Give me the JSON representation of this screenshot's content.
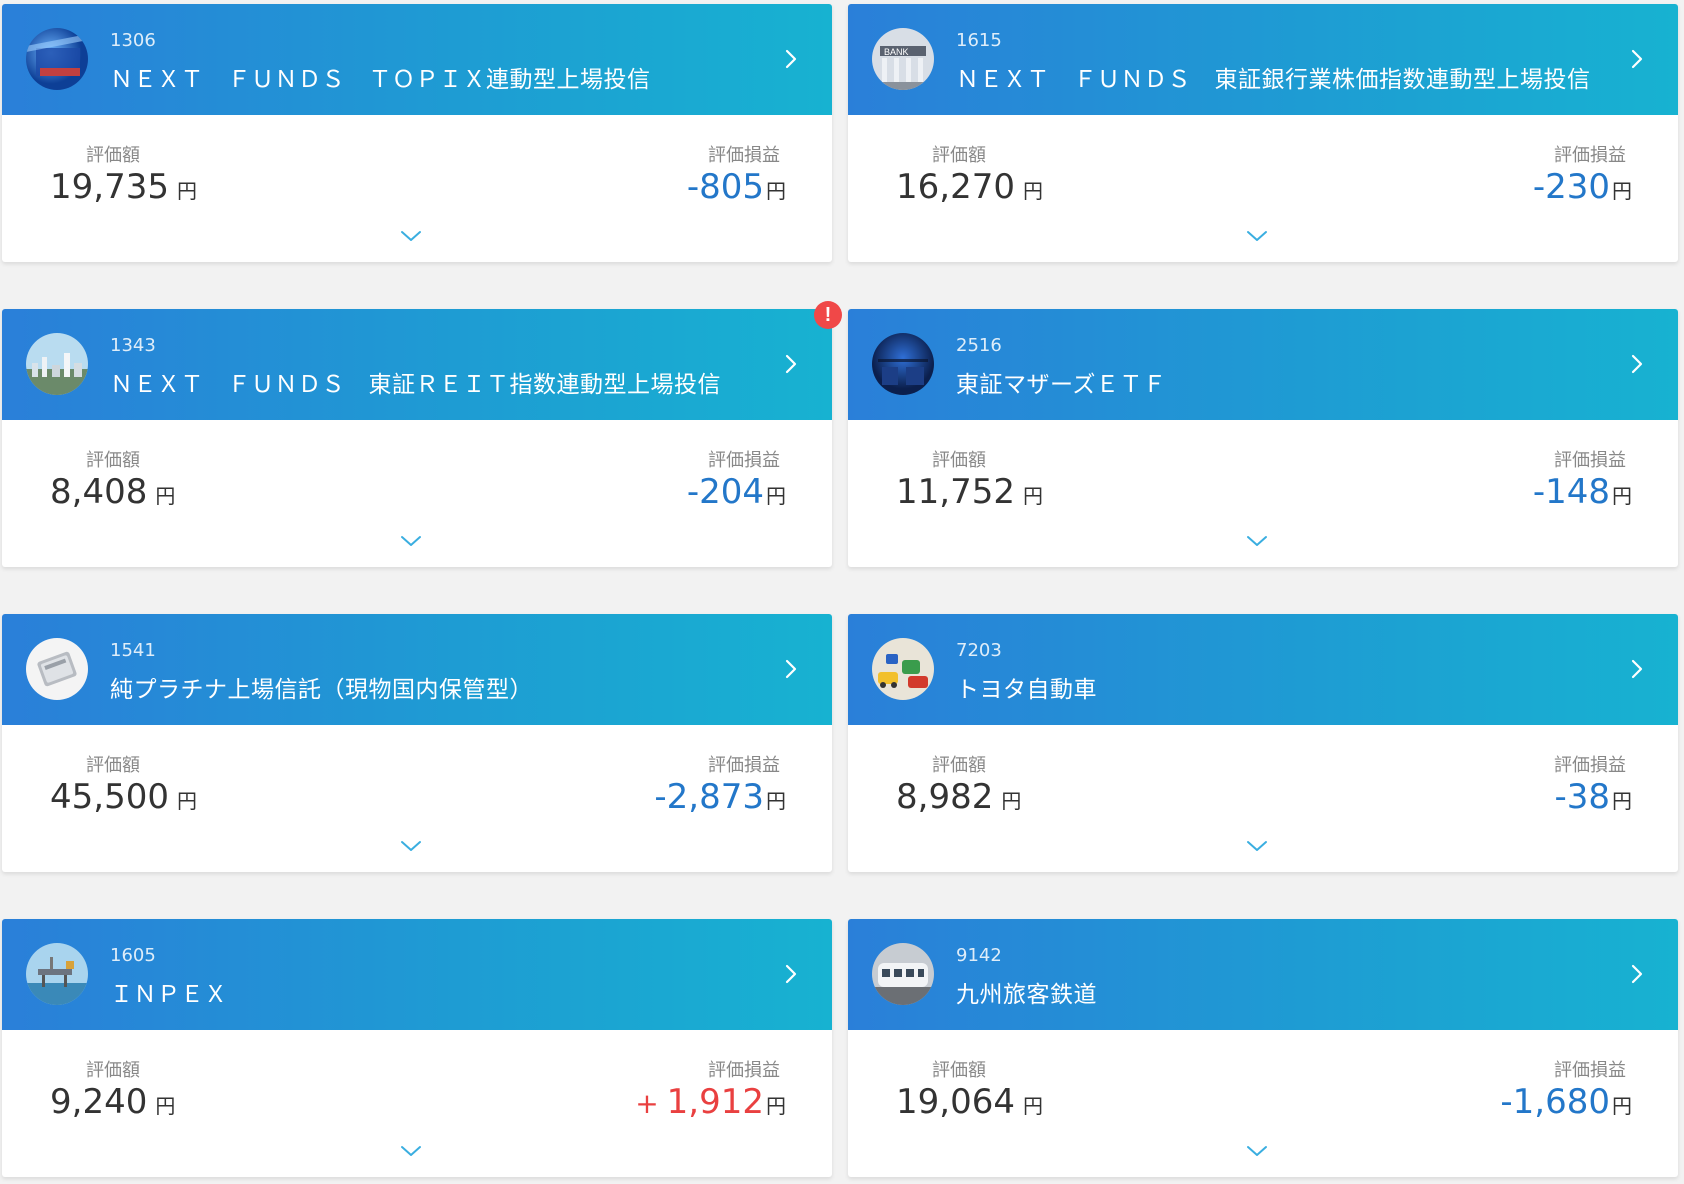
{
  "labels": {
    "valuation": "評価額",
    "profit_loss": "評価損益",
    "currency": "円"
  },
  "colors": {
    "header_start": "#2a7fd9",
    "header_end": "#17b2d1",
    "loss": "#2377c9",
    "gain": "#e94040",
    "alert": "#f04848"
  },
  "holdings": [
    {
      "code": "1306",
      "name": "ＮＥＸＴ　ＦＵＮＤＳ　ＴＯＰＩＸ連動型上場投信",
      "valuation": "19,735",
      "pl_sign": "",
      "pl": "-805",
      "direction": "negative",
      "icon": "building-photo",
      "alert": false
    },
    {
      "code": "1615",
      "name": "ＮＥＸＴ　ＦＵＮＤＳ　東証銀行業株価指数連動型上場投信",
      "valuation": "16,270",
      "pl_sign": "",
      "pl": "-230",
      "direction": "negative",
      "icon": "bank-photo",
      "alert": false
    },
    {
      "code": "1343",
      "name": "ＮＥＸＴ　ＦＵＮＤＳ　東証ＲＥＩＴ指数連動型上場投信",
      "valuation": "8,408",
      "pl_sign": "",
      "pl": "-204",
      "direction": "negative",
      "icon": "city-photo",
      "alert": true,
      "alert_text": "!"
    },
    {
      "code": "2516",
      "name": "東証マザーズＥＴＦ",
      "valuation": "11,752",
      "pl_sign": "",
      "pl": "-148",
      "direction": "negative",
      "icon": "office-photo",
      "alert": false
    },
    {
      "code": "1541",
      "name": "純プラチナ上場信託（現物国内保管型）",
      "valuation": "45,500",
      "pl_sign": "",
      "pl": "-2,873",
      "direction": "negative",
      "icon": "platinum-photo",
      "alert": false
    },
    {
      "code": "7203",
      "name": "トヨタ自動車",
      "valuation": "8,982",
      "pl_sign": "",
      "pl": "-38",
      "direction": "negative",
      "icon": "toy-cars-photo",
      "alert": false
    },
    {
      "code": "1605",
      "name": "ＩＮＰＥＸ",
      "valuation": "9,240",
      "pl_sign": "+",
      "pl": "1,912",
      "direction": "positive",
      "icon": "oil-platform-photo",
      "alert": false
    },
    {
      "code": "9142",
      "name": "九州旅客鉄道",
      "valuation": "19,064",
      "pl_sign": "",
      "pl": "-1,680",
      "direction": "negative",
      "icon": "train-photo",
      "alert": false
    }
  ]
}
